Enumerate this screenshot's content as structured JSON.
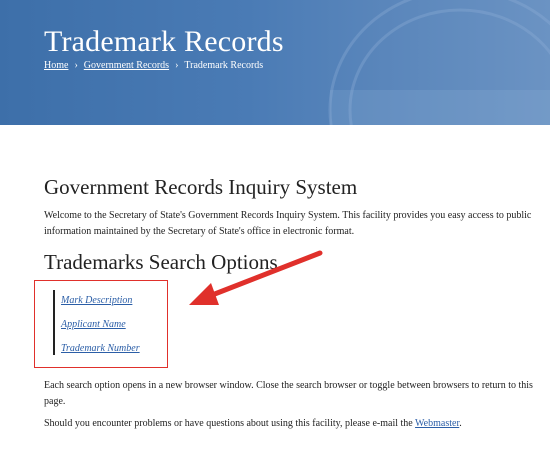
{
  "header": {
    "title": "Trademark Records",
    "breadcrumb": {
      "home": "Home",
      "separator": "›",
      "government_records": "Government Records",
      "current": "Trademark Records"
    }
  },
  "main": {
    "inquiry_heading": "Government Records Inquiry System",
    "welcome_text": "Welcome to the Secretary of State's Government Records Inquiry System. This facility provides you easy access to public information maintained by the Secretary of State's office in electronic format.",
    "search_heading": "Trademarks Search Options",
    "search_options": [
      "Mark Description",
      "Applicant Name",
      "Trademark Number"
    ],
    "each_option_text": "Each search option opens in a new browser window. Close the search browser or toggle between browsers to return to this page.",
    "contact_text": "Should you encounter problems or have questions about using this facility, please e-mail the ",
    "webmaster_link": "Webmaster",
    "contact_end": "."
  },
  "colors": {
    "banner": "#4a7bb5",
    "link": "#2b5ea7",
    "annotation_red": "#e0302b"
  }
}
